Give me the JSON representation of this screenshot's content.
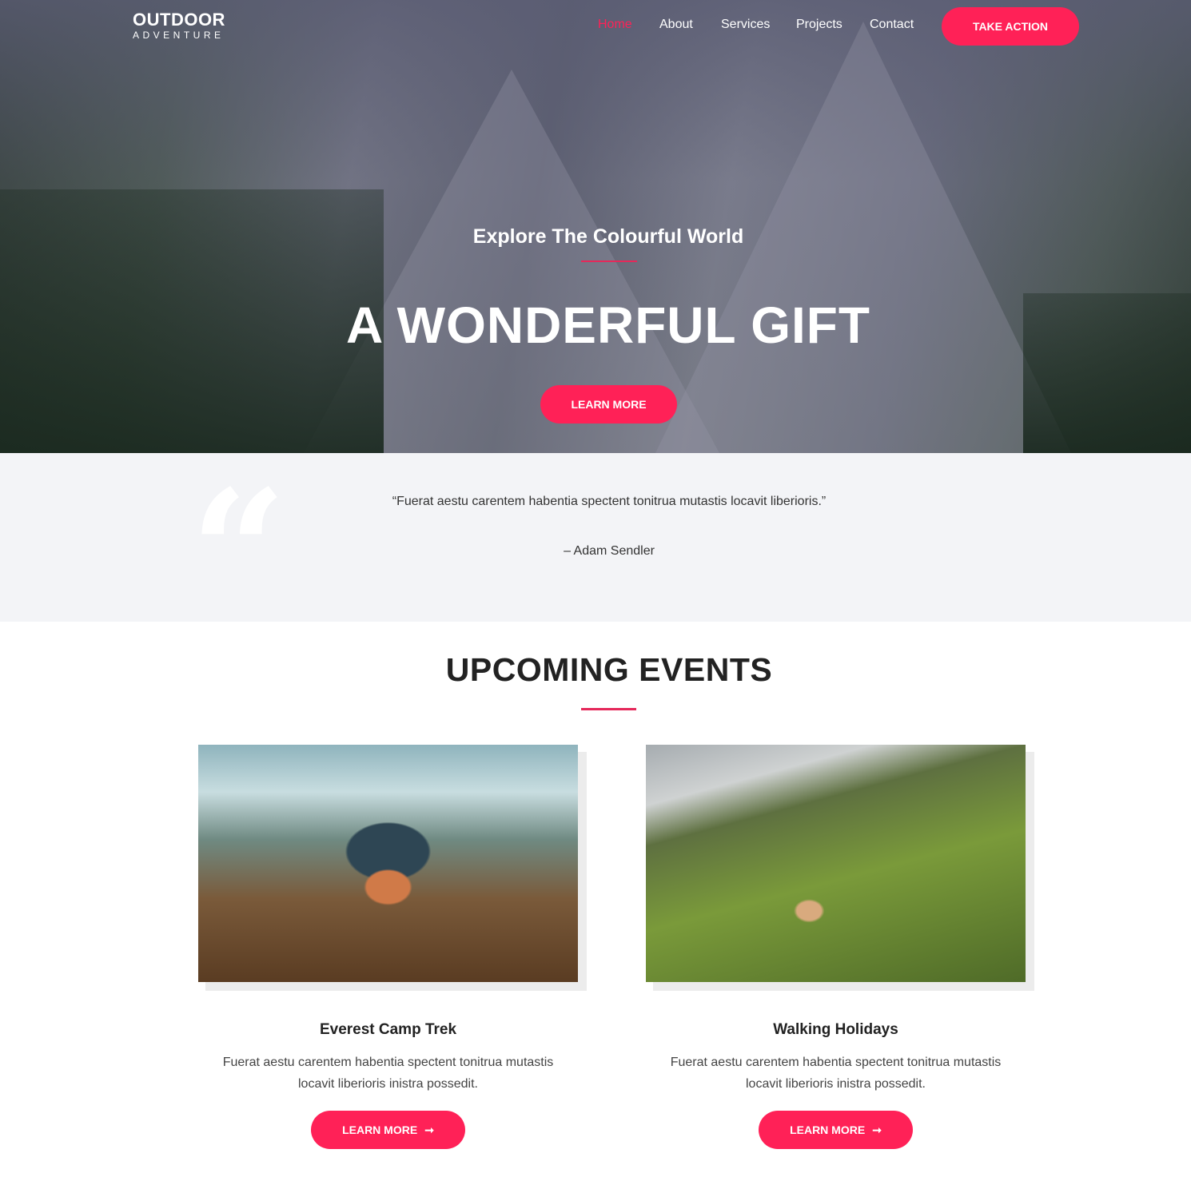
{
  "brand": {
    "line1": "OUTDOOR",
    "line2": "ADVENTURE"
  },
  "nav": {
    "items": [
      "Home",
      "About",
      "Services",
      "Projects",
      "Contact"
    ],
    "active": "Home",
    "cta": "TAKE ACTION"
  },
  "hero": {
    "subtitle": "Explore The Colourful World",
    "title": "A WONDERFUL GIFT",
    "button": "LEARN MORE"
  },
  "testimonial": {
    "quote": "“Fuerat aestu carentem habentia spectent tonitrua mutastis locavit liberioris.”",
    "author": "– Adam Sendler",
    "icon": "quote-icon"
  },
  "events": {
    "title": "UPCOMING EVENTS",
    "items": [
      {
        "title": "Everest Camp Trek",
        "description_line1": "Fuerat aestu carentem habentia spectent tonitrua mutastis",
        "description_line2": "locavit liberioris inistra possedit.",
        "button": "LEARN MORE"
      },
      {
        "title": "Walking Holidays",
        "description_line1": "Fuerat aestu carentem habentia spectent tonitrua mutastis",
        "description_line2": "locavit liberioris inistra possedit.",
        "button": "LEARN MORE"
      }
    ]
  },
  "colors": {
    "accent": "#ff2157",
    "quote_bg": "#f3f4f7"
  }
}
